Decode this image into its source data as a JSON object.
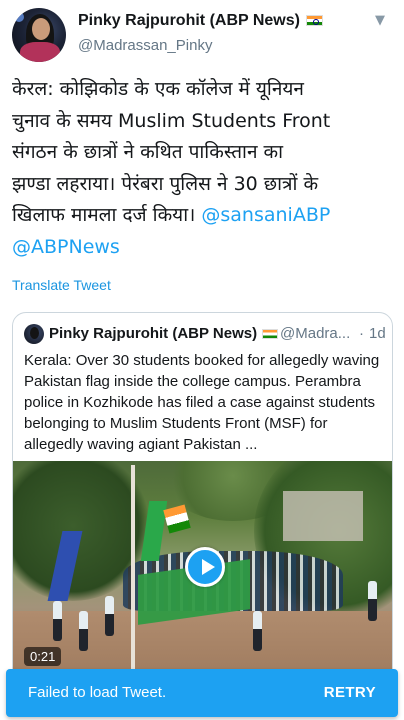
{
  "tweet": {
    "author_name": "Pinky Rajpurohit (ABP News)",
    "author_handle": "@Madrassan_Pinky",
    "text_lines": [
      "केरल: कोझिकोड के एक कॉलेज में यूनियन",
      "चुनाव के समय Muslim Students Front",
      "संगठन के छात्रों ने कथित पाकिस्तान का",
      "झण्डा लहराया। पेरंबरा पुलिस ने 30 छात्रों के",
      "खिलाफ मामला दर्ज किया।"
    ],
    "mention_1": "@sansaniABP",
    "mention_2": "@ABPNews",
    "translate_label": "Translate Tweet",
    "caret_icon": "chevron-down-icon"
  },
  "quote": {
    "author_name": "Pinky Rajpurohit (ABP News)",
    "author_handle": "@Madra...",
    "separator": "·",
    "time": "1d",
    "text": "Kerala: Over 30 students booked for allegedly waving Pakistan flag inside the college campus. Perambra police in Kozhikode has filed a case against students belonging to Muslim Students Front (MSF) for allegedly waving agiant Pakistan ...",
    "video": {
      "duration": "0:21",
      "play_icon": "play-icon"
    }
  },
  "snackbar": {
    "message": "Failed to load Tweet.",
    "action": "RETRY",
    "color": "#1da1f2"
  },
  "colors": {
    "link": "#1da1f2",
    "secondary_text": "#657786",
    "primary_text": "#14171a"
  }
}
